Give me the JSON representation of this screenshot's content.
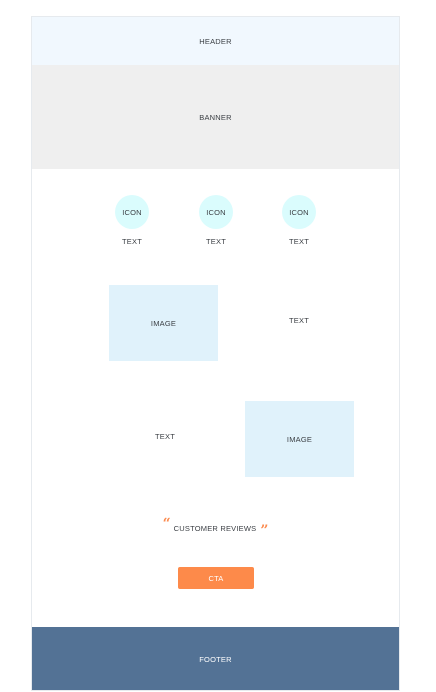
{
  "header": {
    "label": "HEADER"
  },
  "banner": {
    "label": "BANNER"
  },
  "features": [
    {
      "icon": "ICON",
      "text": "TEXT"
    },
    {
      "icon": "ICON",
      "text": "TEXT"
    },
    {
      "icon": "ICON",
      "text": "TEXT"
    }
  ],
  "section1": {
    "image_label": "IMAGE",
    "text": "TEXT"
  },
  "section2": {
    "text": "TEXT",
    "image_label": "IMAGE"
  },
  "reviews": {
    "open_quote": "“",
    "label": "CUSTOMER REVIEWS",
    "close_quote": "”"
  },
  "cta": {
    "label": "CTA"
  },
  "footer": {
    "label": "FOOTER"
  },
  "colors": {
    "header_bg": "#f1f8fe",
    "banner_bg": "#efefef",
    "icon_bg": "#dafcfd",
    "image_bg": "#e0f2fb",
    "accent": "#fd8a4a",
    "footer_bg": "#537295"
  }
}
